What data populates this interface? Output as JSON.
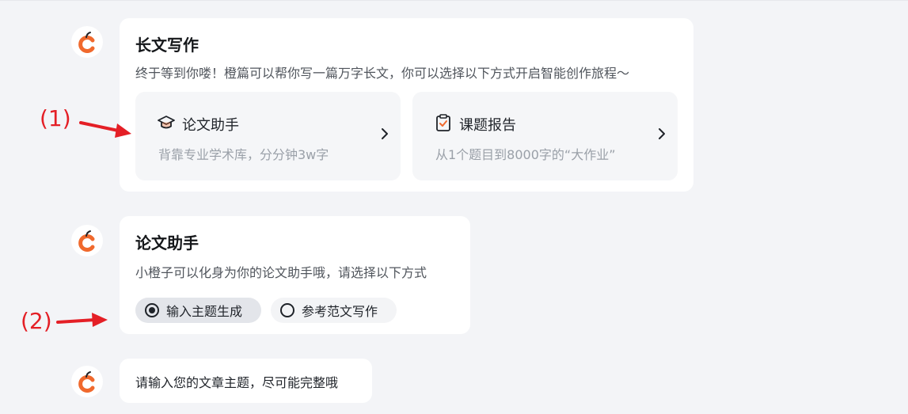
{
  "colors": {
    "background": "#f3f4f7",
    "bubble": "#ffffff",
    "accent_orange": "#f0692d",
    "annotation_red": "#e41f26"
  },
  "long_writing_card": {
    "title": "长文写作",
    "description": "终于等到你喽！橙篇可以帮你写一篇万字长文，你可以选择以下方式开启智能创作旅程～",
    "options": [
      {
        "icon": "graduation-cap-icon",
        "title": "论文助手",
        "subtitle": "背靠专业学术库，分分钟3w字"
      },
      {
        "icon": "clipboard-check-icon",
        "title": "课题报告",
        "subtitle": "从1个题目到8000字的“大作业”"
      }
    ]
  },
  "thesis_card": {
    "title": "论文助手",
    "description": "小橙子可以化身为你的论文助手哦，请选择以下方式",
    "modes": [
      {
        "label": "输入主题生成",
        "selected": true
      },
      {
        "label": "参考范文写作",
        "selected": false
      }
    ]
  },
  "prompt_message": {
    "text": "请输入您的文章主题，尽可能完整哦"
  },
  "annotations": {
    "one": "(1)",
    "two": "(2)"
  }
}
